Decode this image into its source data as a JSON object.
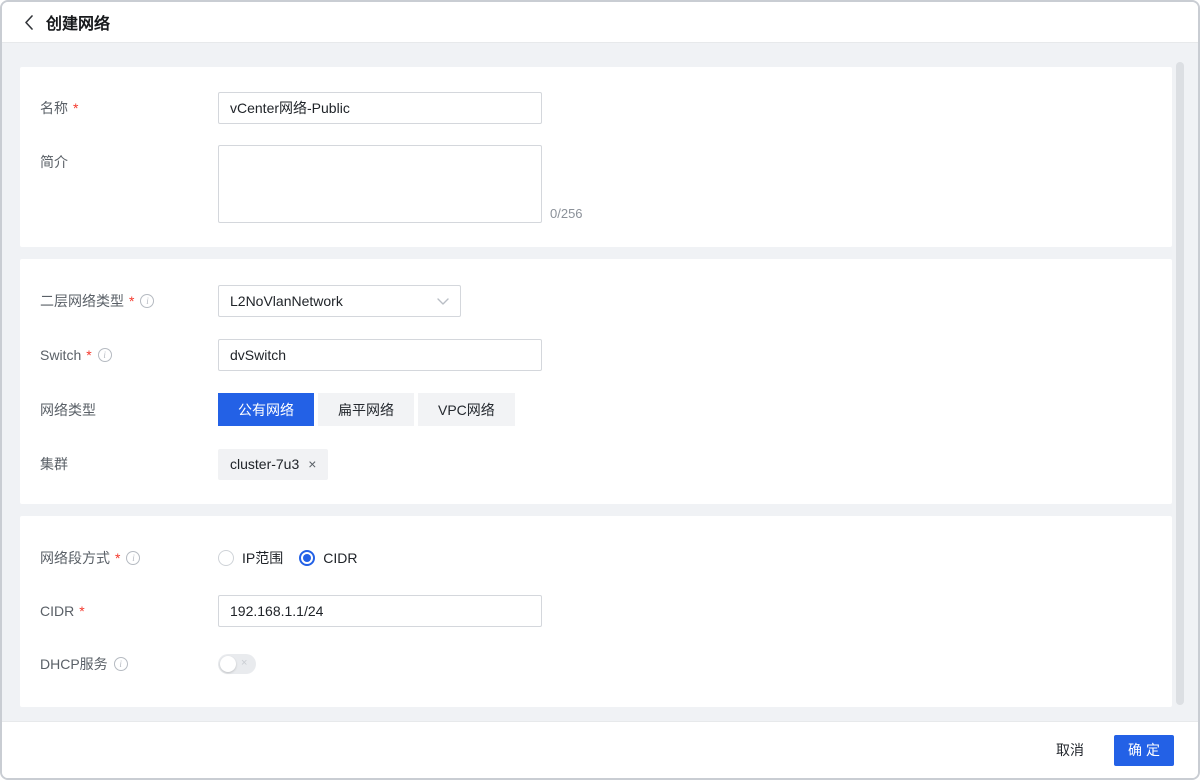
{
  "header": {
    "title": "创建网络"
  },
  "misc": {
    "required_marker": "*"
  },
  "icons": {
    "info_glyph": "i",
    "close_glyph": "×"
  },
  "basic": {
    "name_label": "名称",
    "name_value": "vCenter网络-Public",
    "desc_label": "简介",
    "desc_value": "",
    "desc_counter": "0/256"
  },
  "network": {
    "l2_type_label": "二层网络类型",
    "l2_type_value": "L2NoVlanNetwork",
    "switch_label": "Switch",
    "switch_value": "dvSwitch",
    "net_type_label": "网络类型",
    "net_type_options": [
      "公有网络",
      "扁平网络",
      "VPC网络"
    ],
    "net_type_selected": "公有网络",
    "cluster_label": "集群",
    "cluster_tag": "cluster-7u3"
  },
  "segment": {
    "method_label": "网络段方式",
    "method_options": [
      "IP范围",
      "CIDR"
    ],
    "method_selected": "CIDR",
    "cidr_label": "CIDR",
    "cidr_value": "192.168.1.1/24",
    "dhcp_label": "DHCP服务",
    "dhcp_enabled": false
  },
  "footer": {
    "cancel_label": "取消",
    "confirm_label": "确定"
  },
  "colors": {
    "accent": "#2361e6",
    "required": "#f5382c",
    "page_background": "#f0f2f5"
  }
}
